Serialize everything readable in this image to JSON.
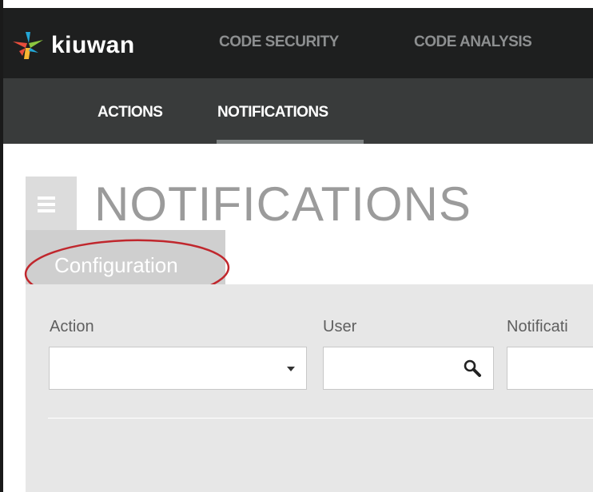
{
  "app": {
    "logo_text": "kiuwan"
  },
  "topnav": {
    "items": [
      {
        "label": "CODE SECURITY"
      },
      {
        "label": "CODE ANALYSIS"
      }
    ]
  },
  "subnav": {
    "items": [
      {
        "label": "ACTIONS"
      },
      {
        "label": "NOTIFICATIONS",
        "active": true
      }
    ]
  },
  "page": {
    "title": "NOTIFICATIONS",
    "config_tab": "Configuration"
  },
  "filters": {
    "action_label": "Action",
    "action_value": "",
    "user_label": "User",
    "user_value": "",
    "notification_label": "Notificati"
  },
  "colors": {
    "topbar": "#1e1f1f",
    "subbar": "#393b3b",
    "highlight_ellipse": "#c0272d"
  }
}
